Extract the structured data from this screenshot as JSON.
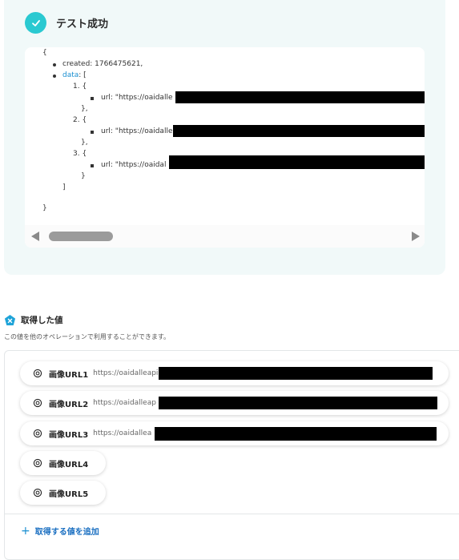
{
  "test_result": {
    "status": "テスト成功"
  },
  "json_output": {
    "open_brace": "{",
    "created_line": "created: 1766475621,",
    "data_key": "data",
    "data_open": ": [",
    "items": [
      {
        "index": "1. {",
        "url_prefix": "url: \"https://oaidalle",
        "close": "},"
      },
      {
        "index": "2. {",
        "url_prefix": "url: \"https://oaidalle",
        "close": "},"
      },
      {
        "index": "3. {",
        "url_prefix": "url: \"https://oaidal",
        "close": "}"
      }
    ],
    "data_close": "]",
    "close_brace": "}"
  },
  "acquired_values": {
    "title": "取得した値",
    "description": "この値を他のオペレーションで利用することができます。",
    "items": [
      {
        "label": "画像URL1",
        "value": "https://oaidalleapi"
      },
      {
        "label": "画像URL2",
        "value": "https://oaidalleap"
      },
      {
        "label": "画像URL3",
        "value": "https://oaidallea"
      },
      {
        "label": "画像URL4",
        "value": ""
      },
      {
        "label": "画像URL5",
        "value": ""
      }
    ],
    "add_label": "取得する値を追加",
    "add_icon": "+"
  },
  "colors": {
    "accent": "#2ac9d1",
    "link": "#1a6fc1",
    "panel_bg": "#f1f9f9"
  },
  "icons": {
    "status": "check-circle-icon",
    "section": "pentagon-x-icon",
    "chip": "openai-icon",
    "add": "plus-icon"
  }
}
